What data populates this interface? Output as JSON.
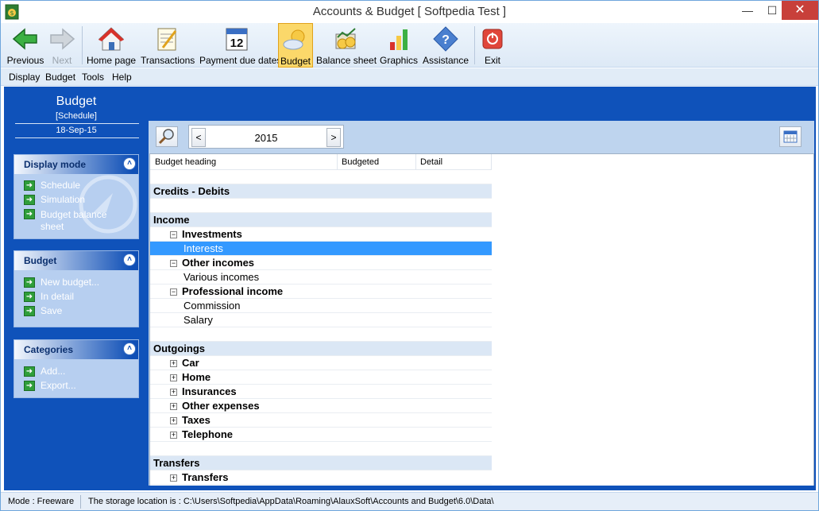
{
  "window": {
    "title": "Accounts & Budget [ Softpedia Test ]",
    "controls": {
      "minimize": "—",
      "maximize": "☐",
      "close": "✕"
    }
  },
  "toolbar": {
    "previous": "Previous",
    "next": "Next",
    "home_page": "Home page",
    "transactions": "Transactions",
    "payment_due_dates": "Payment due dates",
    "calendar_day": "12",
    "budget": "Budget",
    "balance_sheet": "Balance sheet",
    "graphics": "Graphics",
    "assistance": "Assistance",
    "exit": "Exit"
  },
  "menu": {
    "display": "Display",
    "budget": "Budget",
    "tools": "Tools",
    "help": "Help"
  },
  "sidebar": {
    "title": "Budget",
    "subtitle": "[Schedule]",
    "date": "18-Sep-15",
    "panels": [
      {
        "title": "Display mode",
        "items": [
          "Schedule",
          "Simulation",
          "Budget balance sheet"
        ]
      },
      {
        "title": "Budget",
        "items": [
          "New budget...",
          "In detail",
          "Save"
        ]
      },
      {
        "title": "Categories",
        "items": [
          "Add...",
          "Export..."
        ]
      }
    ],
    "collapse_glyph": "˄"
  },
  "content": {
    "year": "2015",
    "prev_glyph": "<",
    "next_glyph": ">",
    "columns": [
      "Budget heading",
      "Budgeted",
      "Detail"
    ],
    "rows": [
      {
        "type": "blank",
        "label": ""
      },
      {
        "type": "section",
        "label": "Credits - Debits"
      },
      {
        "type": "blank",
        "label": ""
      },
      {
        "type": "section",
        "label": "Income"
      },
      {
        "type": "group",
        "label": "Investments",
        "toggle": "−"
      },
      {
        "type": "leaf",
        "label": "Interests",
        "selected": true
      },
      {
        "type": "group",
        "label": "Other incomes",
        "toggle": "−"
      },
      {
        "type": "leaf",
        "label": "Various incomes"
      },
      {
        "type": "group",
        "label": "Professional income",
        "toggle": "−"
      },
      {
        "type": "leaf",
        "label": "Commission"
      },
      {
        "type": "leaf",
        "label": "Salary"
      },
      {
        "type": "blank",
        "label": ""
      },
      {
        "type": "section",
        "label": "Outgoings"
      },
      {
        "type": "group",
        "label": "Car",
        "toggle": "+"
      },
      {
        "type": "group",
        "label": "Home",
        "toggle": "+"
      },
      {
        "type": "group",
        "label": "Insurances",
        "toggle": "+"
      },
      {
        "type": "group",
        "label": "Other expenses",
        "toggle": "+"
      },
      {
        "type": "group",
        "label": "Taxes",
        "toggle": "+"
      },
      {
        "type": "group",
        "label": "Telephone",
        "toggle": "+"
      },
      {
        "type": "blank",
        "label": ""
      },
      {
        "type": "section",
        "label": "Transfers"
      },
      {
        "type": "group",
        "label": "Transfers",
        "toggle": "+"
      }
    ]
  },
  "status": {
    "mode": "Mode : Freeware",
    "storage": "The storage location is : C:\\Users\\Softpedia\\AppData\\Roaming\\AlauxSoft\\Accounts and Budget\\6.0\\Data\\"
  },
  "colors": {
    "accent": "#0f52ba",
    "selection": "#3399ff",
    "active_tool": "#fbd86a",
    "close": "#c8403a"
  }
}
